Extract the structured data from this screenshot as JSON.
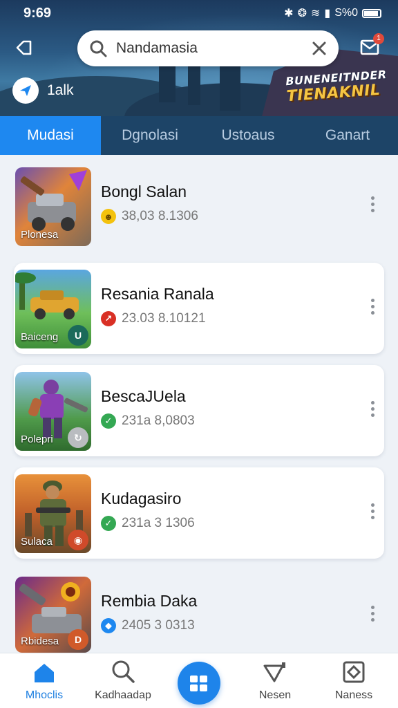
{
  "status_bar": {
    "time": "9:69",
    "right_text": "S%0"
  },
  "header": {
    "search_value": "Nandamasia",
    "profile_name": "1alk",
    "mail_badge": "1",
    "banner_line1": "BUNENEITNDER",
    "banner_line2": "TIENAKNIL"
  },
  "tabs": [
    {
      "label": "Mudasi",
      "active": true
    },
    {
      "label": "Dgnolasi",
      "active": false
    },
    {
      "label": "Ustoaus",
      "active": false
    },
    {
      "label": "Ganart",
      "active": false
    }
  ],
  "items": [
    {
      "title": "Bongl Salan",
      "meta": "38,03 8.1306",
      "thumb_label": "Plonesa",
      "status_icon": "smile-icon",
      "status_color": "#f4c20d"
    },
    {
      "title": "Resania Ranala",
      "meta": "23.03 8.10121",
      "thumb_label": "Baiceng",
      "corner_glyph": "U",
      "status_icon": "alert-icon",
      "status_color": "#d93025"
    },
    {
      "title": "BescaJUela",
      "meta": "231a 8,0803",
      "thumb_label": "Polepri",
      "status_icon": "check-icon",
      "status_color": "#34a853"
    },
    {
      "title": "Kudagasiro",
      "meta": "231a 3 1306",
      "thumb_label": "Sulaca",
      "status_icon": "check-icon",
      "status_color": "#34a853"
    },
    {
      "title": "Rembia Daka",
      "meta": "2405 3 0313",
      "thumb_label": "Rbidesa",
      "corner_glyph": "D",
      "status_icon": "diamond-icon",
      "status_color": "#1e88f0"
    }
  ],
  "bottom_nav": [
    {
      "label": "Mhoclis",
      "icon": "home-icon",
      "active": true
    },
    {
      "label": "Kadhaadap",
      "icon": "search-icon",
      "active": false
    },
    {
      "label": "Nesen",
      "icon": "send-icon",
      "active": false
    },
    {
      "label": "Naness",
      "icon": "box-icon",
      "active": false
    }
  ],
  "colors": {
    "accent": "#1e88f0",
    "tab_bar": "#1d4467",
    "background": "#eef2f7"
  }
}
